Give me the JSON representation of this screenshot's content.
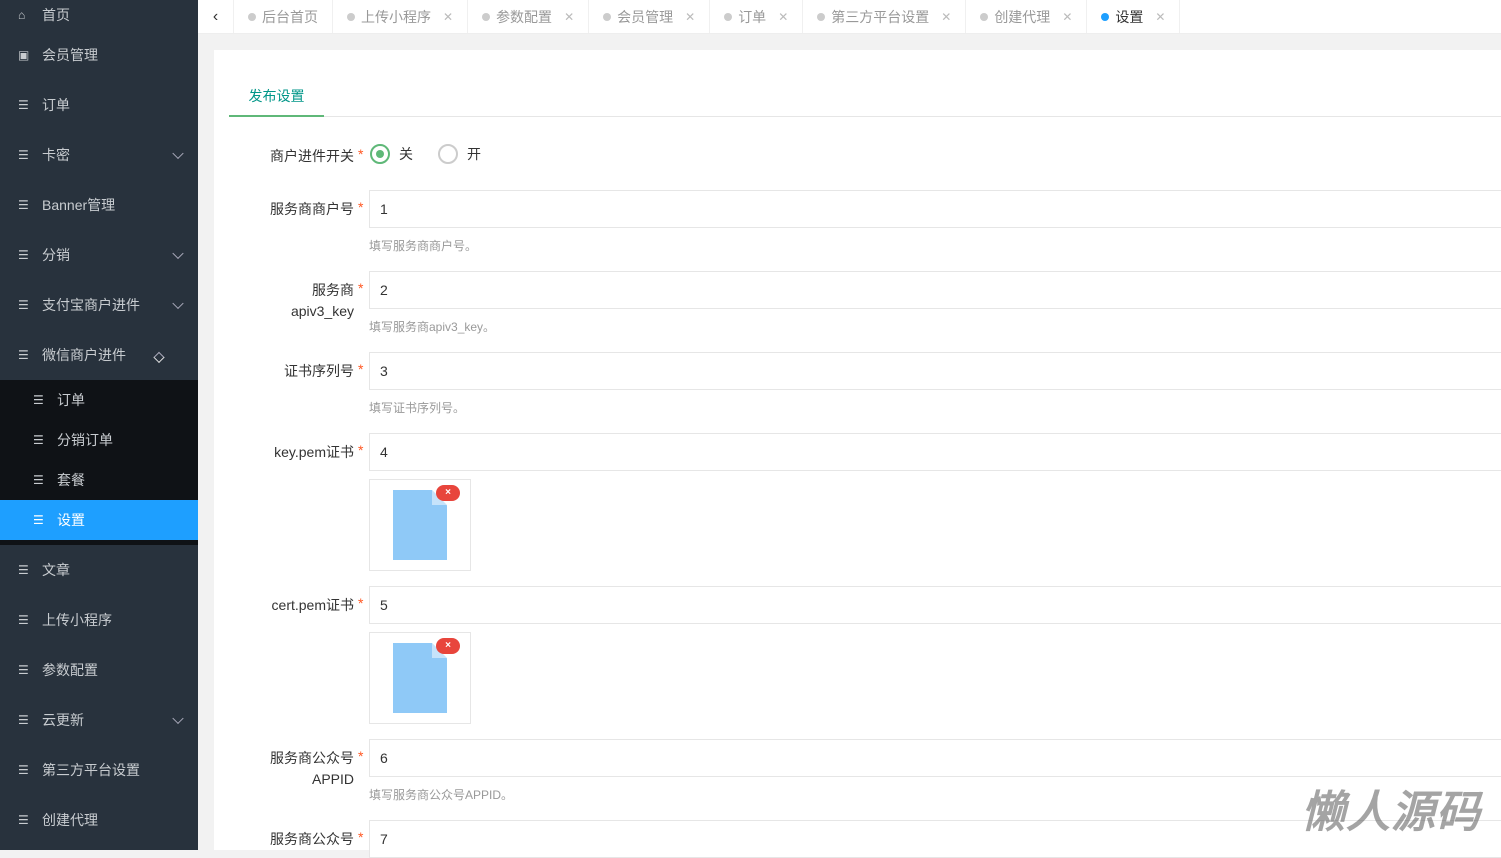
{
  "sidebar": {
    "items": [
      {
        "label": "首页",
        "icon": "home-icon"
      },
      {
        "label": "会员管理",
        "icon": "member-icon"
      },
      {
        "label": "订单",
        "icon": "list-icon"
      },
      {
        "label": "卡密",
        "icon": "list-icon",
        "expandable": true
      },
      {
        "label": "Banner管理",
        "icon": "list-icon"
      },
      {
        "label": "分销",
        "icon": "list-icon",
        "expandable": true
      },
      {
        "label": "支付宝商户进件",
        "icon": "list-icon",
        "expandable": true
      },
      {
        "label": "微信商户进件",
        "icon": "list-icon",
        "expanded": true
      }
    ],
    "submenu": [
      {
        "label": "订单"
      },
      {
        "label": "分销订单"
      },
      {
        "label": "套餐"
      },
      {
        "label": "设置",
        "active": true
      }
    ],
    "items_after": [
      {
        "label": "文章"
      },
      {
        "label": "上传小程序"
      },
      {
        "label": "参数配置"
      },
      {
        "label": "云更新",
        "expandable": true
      },
      {
        "label": "第三方平台设置"
      },
      {
        "label": "创建代理"
      }
    ]
  },
  "tabs": [
    {
      "label": "后台首页"
    },
    {
      "label": "上传小程序"
    },
    {
      "label": "参数配置"
    },
    {
      "label": "会员管理"
    },
    {
      "label": "订单"
    },
    {
      "label": "第三方平台设置"
    },
    {
      "label": "创建代理"
    },
    {
      "label": "设置",
      "active": true
    }
  ],
  "content": {
    "tab": "发布设置",
    "switch": {
      "label": "商户进件开关",
      "options": [
        "关",
        "开"
      ],
      "selected": "关"
    },
    "fields": [
      {
        "label": "服务商商户号",
        "value": "1",
        "help": "填写服务商商户号。"
      },
      {
        "label": "服务商 apiv3_key",
        "label1": "服务商",
        "label2": "apiv3_key",
        "value": "2",
        "help": "填写服务商apiv3_key。"
      },
      {
        "label": "证书序列号",
        "value": "3",
        "help": "填写证书序列号。"
      },
      {
        "label": "key.pem证书",
        "value": "4"
      },
      {
        "label": "cert.pem证书",
        "value": "5"
      },
      {
        "label1": "服务商公众号",
        "label2": "APPID",
        "value": "6",
        "help": "填写服务商公众号APPID。"
      },
      {
        "label": "服务商公众号",
        "value": "7"
      }
    ],
    "required_mark": "*",
    "delete_mark": "×"
  },
  "watermark": "懒人源码"
}
